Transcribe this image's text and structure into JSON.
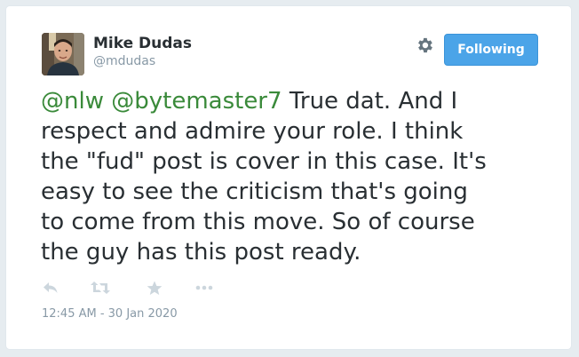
{
  "author": {
    "name": "Mike Dudas",
    "handle": "@mdudas"
  },
  "header": {
    "settings_icon": "gear-icon",
    "follow_label": "Following"
  },
  "tweet": {
    "mentions": [
      "@nlw",
      "@bytemaster7"
    ],
    "line1_rest": "True dat. And I",
    "lines": [
      "respect and admire your role. I think",
      "the \"fud\" post is cover in this case. It's",
      "easy to see the criticism that's going",
      "to come from this move. So of course",
      "the guy has this post ready."
    ],
    "timestamp": "12:45 AM - 30 Jan 2020"
  },
  "actions": [
    {
      "icon": "reply-icon"
    },
    {
      "icon": "retweet-icon"
    },
    {
      "icon": "like-star-icon"
    },
    {
      "icon": "more-icon"
    }
  ],
  "colors": {
    "mention": "#3a8a3a",
    "button": "#4ba4e8",
    "text": "#292f33",
    "muted": "#8899a6"
  }
}
